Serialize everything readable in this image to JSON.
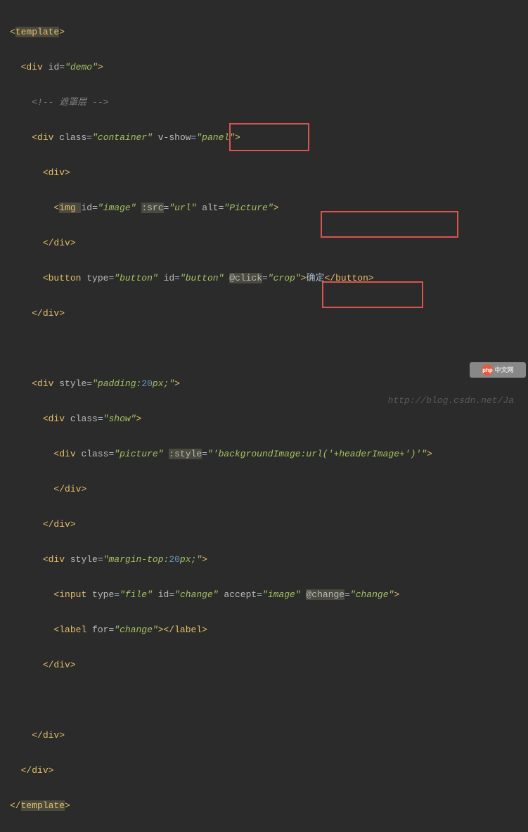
{
  "code": {
    "l1a": "<",
    "l1_tag": "template",
    "l1b": ">",
    "l2a": "<",
    "l2_tag": "div ",
    "l2_attr": "id",
    "l2_eq": "=",
    "l2_q": "\"",
    "l2_val": "demo",
    "l2b": ">",
    "l3a": "<!-- ",
    "l3_txt": "遮罩层 ",
    "l3b": "-->",
    "l4a": "<",
    "l4_tag": "div ",
    "l4_attr1": "class",
    "l4_eq": "=",
    "l4_q": "\"",
    "l4_val1": "container",
    "l4_attr2": "v-show",
    "l4_val2": "panel",
    "l4b": ">",
    "l5a": "<",
    "l5_tag": "div",
    "l5b": ">",
    "l6a": "<",
    "l6_tag": "img ",
    "l6_attr1": "id",
    "l6_val1": "image",
    "l6_attr2": ":src",
    "l6_val2": "url",
    "l6_attr3": "alt",
    "l6_val3": "Picture",
    "l6b": ">",
    "l7a": "</",
    "l7_tag": "div",
    "l7b": ">",
    "l8a": "<",
    "l8_tag": "button ",
    "l8_attr1": "type",
    "l8_val1": "button",
    "l8_attr2": "id",
    "l8_val2": "button",
    "l8_attr3": "@click",
    "l8_val3": "crop",
    "l8b": ">",
    "l8_text": "确定",
    "l8c": "</",
    "l8_tag2": "button",
    "l8d": ">",
    "l9a": "</",
    "l9_tag": "div",
    "l9b": ">",
    "l10a": "<",
    "l10_tag": "div ",
    "l10_attr1": "style",
    "l10_val1": "padding:20px;",
    "l10_val1_num": "20",
    "l10_val1_a": "padding:",
    "l10_val1_b": "px;",
    "l10b": ">",
    "l11a": "<",
    "l11_tag": "div ",
    "l11_attr1": "class",
    "l11_val1": "show",
    "l11b": ">",
    "l12a": "<",
    "l12_tag": "div ",
    "l12_attr1": "class",
    "l12_val1": "picture",
    "l12_attr2": ":style",
    "l12_val2": "'backgroundImage:url('+headerImage+')'",
    "l12b": ">",
    "l13a": "</",
    "l13_tag": "div",
    "l13b": ">",
    "l14a": "</",
    "l14_tag": "div",
    "l14b": ">",
    "l15a": "<",
    "l15_tag": "div ",
    "l15_attr1": "style",
    "l15_val1_a": "margin-top:",
    "l15_val1_num": "20",
    "l15_val1_b": "px;",
    "l15b": ">",
    "l16a": "<",
    "l16_tag": "input ",
    "l16_attr1": "type",
    "l16_val1": "file",
    "l16_attr2": "id",
    "l16_val2": "change",
    "l16_attr3": "accept",
    "l16_val3": "image",
    "l16_attr4": "@change",
    "l16_val4": "change",
    "l16b": ">",
    "l17a": "<",
    "l17_tag": "label ",
    "l17_attr1": "for",
    "l17_val1": "change",
    "l17b": "></",
    "l17_tag2": "label",
    "l17c": ">",
    "l18a": "</",
    "l18_tag": "div",
    "l18b": ">",
    "l19a": "</",
    "l19_tag": "div",
    "l19b": ">",
    "l20a": "</",
    "l20_tag": "div",
    "l20b": ">",
    "l21a": "</",
    "l21_tag": "template",
    "l21b": ">"
  },
  "watermark": "http://blog.csdn.net/Ja",
  "logo_php": "php",
  "logo_txt": "中文网"
}
